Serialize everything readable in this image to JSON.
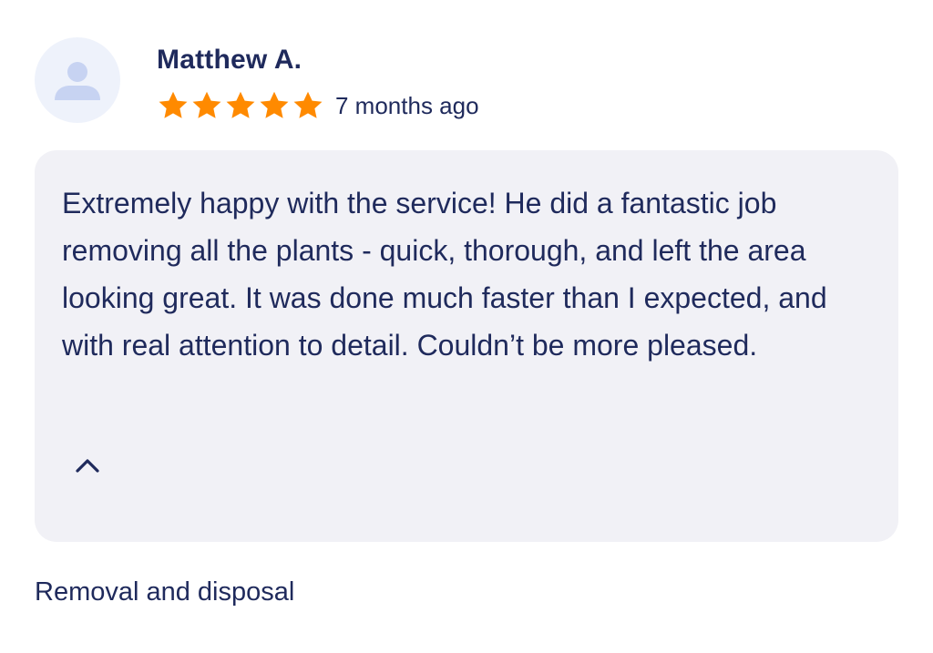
{
  "review": {
    "reviewer_name": "Matthew A.",
    "avatar_icon": "user-silhouette-icon",
    "rating": 5,
    "rating_max": 5,
    "star_color": "#ff8a00",
    "date": "7 months ago",
    "text": "Extremely happy with the service! He did a fantastic job removing all the plants - quick, thorough, and left the area looking great. It was done much faster than I expected, and with real attention to detail. Couldn’t be more pleased.",
    "collapse_icon": "chevron-up-icon",
    "service_tag": "Removal and disposal"
  },
  "colors": {
    "text": "#1f2a5c",
    "box_background": "#f1f1f6",
    "avatar_background": "#eef2fb",
    "avatar_icon": "#c7d3f2"
  }
}
